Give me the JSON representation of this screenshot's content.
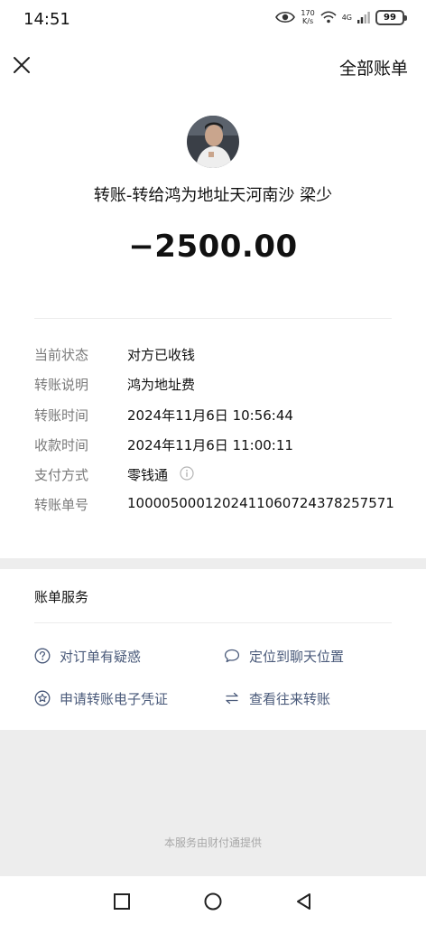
{
  "status_bar": {
    "time": "14:51",
    "net_speed_value": "170",
    "net_speed_unit": "K/s",
    "signal_label": "4G",
    "battery": "99",
    "icons": [
      "eye-icon",
      "wifi-icon",
      "signal-icon",
      "battery-icon"
    ]
  },
  "nav": {
    "close_icon": "close-icon",
    "all_bills_label": "全部账单"
  },
  "transfer": {
    "title": "转账-转给鸿为地址天河南沙 梁少",
    "amount": "−2500.00"
  },
  "details": [
    {
      "label": "当前状态",
      "value": "对方已收钱"
    },
    {
      "label": "转账说明",
      "value": "鸿为地址费"
    },
    {
      "label": "转账时间",
      "value": "2024年11月6日 10:56:44"
    },
    {
      "label": "收款时间",
      "value": "2024年11月6日 11:00:11"
    },
    {
      "label": "支付方式",
      "value": "零钱通"
    },
    {
      "label": "转账单号",
      "value": "1000050001202411060724378257571"
    }
  ],
  "services": {
    "title": "账单服务",
    "items": [
      {
        "label": "对订单有疑惑",
        "icon": "question-circle-icon"
      },
      {
        "label": "定位到聊天位置",
        "icon": "chat-bubble-icon"
      },
      {
        "label": "申请转账电子凭证",
        "icon": "star-circle-icon"
      },
      {
        "label": "查看往来转账",
        "icon": "transfer-arrows-icon"
      }
    ]
  },
  "footer": {
    "text": "本服务由财付通提供"
  },
  "system_nav": {
    "icons": [
      "recent-apps-icon",
      "home-icon",
      "back-icon"
    ]
  },
  "colors": {
    "link": "#4a5a7a",
    "label_gray": "#7a7a7a",
    "background": "#ededed"
  }
}
